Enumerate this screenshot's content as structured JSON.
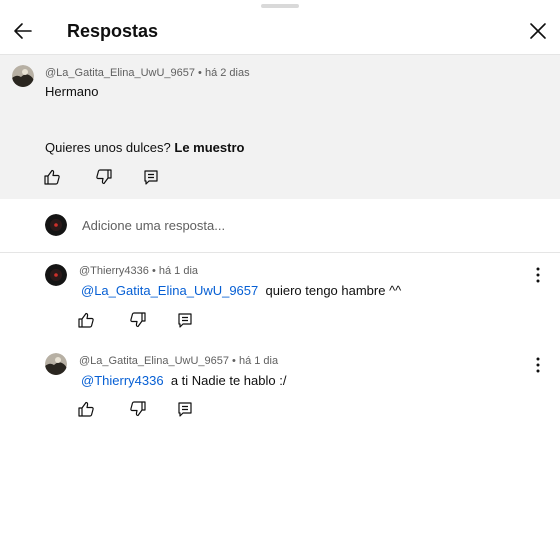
{
  "header": {
    "title": "Respostas"
  },
  "parent_comment": {
    "author": "@La_Gatita_Elina_UwU_9657",
    "time": "há 2 dias",
    "line1": "Hermano",
    "line2": "Quieres unos dulces?",
    "line2_bold": "Le muestro"
  },
  "reply_box": {
    "placeholder": "Adicione uma resposta..."
  },
  "replies": [
    {
      "author": "@Thierry4336",
      "time": "há 1 dia",
      "mention": "@La_Gatita_Elina_UwU_9657",
      "text": "quiero tengo hambre ^^"
    },
    {
      "author": "@La_Gatita_Elina_UwU_9657",
      "time": "há 1 dia",
      "mention": "@Thierry4336",
      "text": "a ti Nadie te hablo :/"
    }
  ],
  "separator": "•",
  "icons": {
    "back": "arrow-left-icon",
    "close": "close-icon",
    "like": "thumbs-up-icon",
    "dislike": "thumbs-down-icon",
    "reply": "reply-icon",
    "more": "more-vert-icon"
  },
  "colors": {
    "mention": "#065fd4",
    "parent_bg": "#f2f2f2",
    "meta_text": "#606060"
  }
}
